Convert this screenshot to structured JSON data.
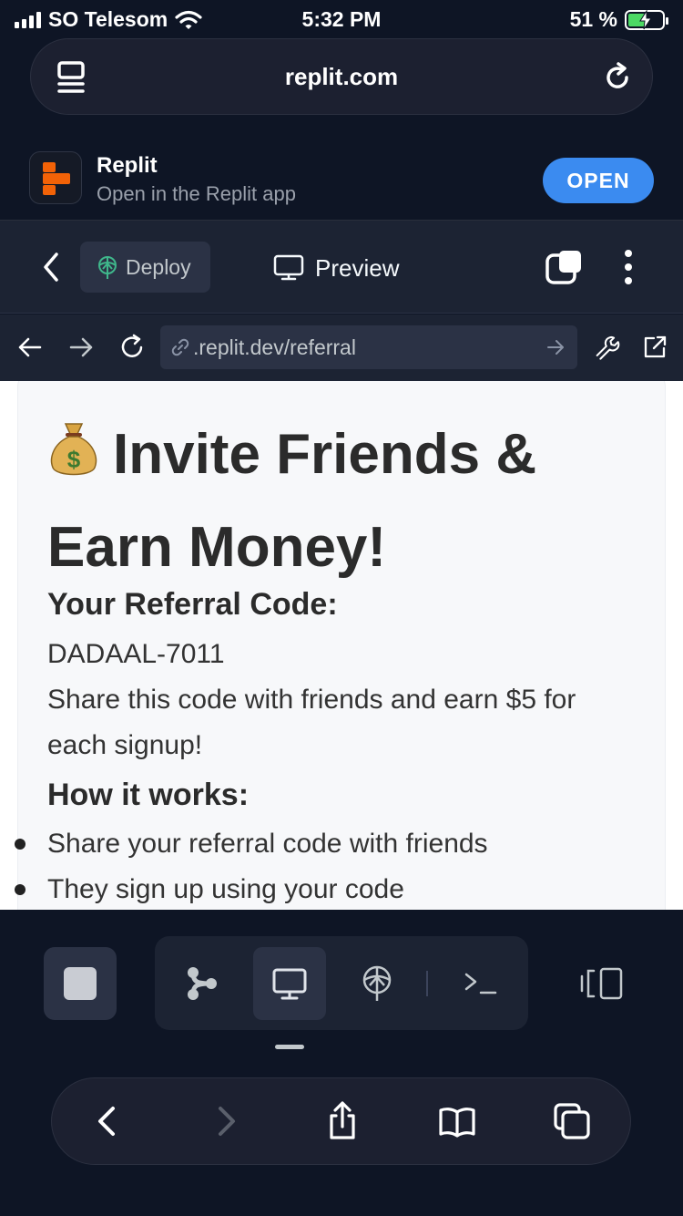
{
  "status_bar": {
    "carrier": "SO Telesom",
    "time": "5:32 PM",
    "battery_percent": "51 %",
    "battery_level": 0.51,
    "charging": true
  },
  "browser": {
    "url_display": "replit.com"
  },
  "app_banner": {
    "title": "Replit",
    "subtitle": "Open in the Replit app",
    "open_label": "OPEN"
  },
  "toolbar": {
    "deploy_label": "Deploy",
    "preview_label": "Preview"
  },
  "webview": {
    "address": ".replit.dev/referral"
  },
  "page": {
    "title_line1": "Invite Friends &",
    "title_line2": "Earn Money!",
    "referral_heading": "Your Referral Code:",
    "referral_code": "DADAAL-7011",
    "share_line1": "Share this code with friends and earn $5 for",
    "share_line2": "each signup!",
    "how_heading": "How it works:",
    "steps": [
      "Share your referral code with friends",
      "They sign up using your code"
    ]
  },
  "colors": {
    "accent": "#3b8bf0",
    "background": "#0e1525",
    "toolbar": "#1c2333",
    "battery_charging": "#4cd964"
  },
  "icons": {
    "urlbar_left": "reader-icon",
    "urlbar_right": "reload-icon",
    "panes": [
      "git-icon",
      "monitor-icon",
      "deploy-icon",
      "terminal-icon"
    ]
  }
}
